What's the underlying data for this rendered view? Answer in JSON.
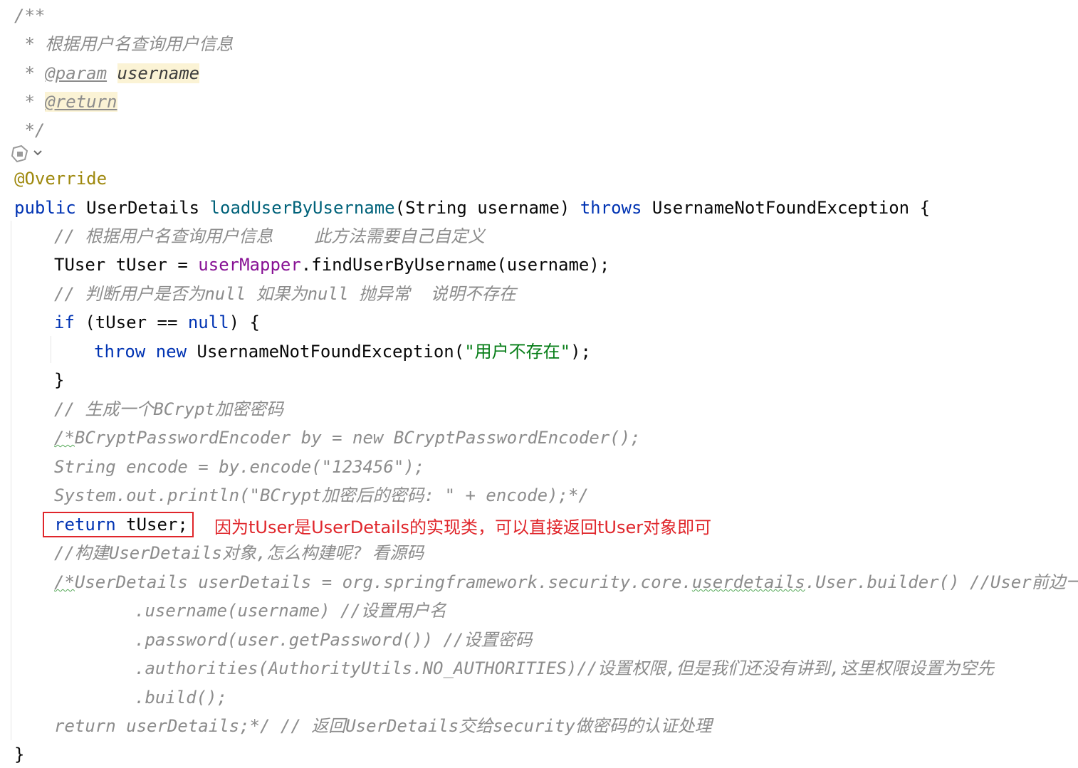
{
  "javadoc": {
    "open": "/**",
    "summary_prefix": " * ",
    "summary": "根据用户名查询用户信息",
    "param_prefix": " * ",
    "param_tag": "@param",
    "param_name": "username",
    "return_prefix": " * ",
    "return_tag": "@return",
    "close": " */"
  },
  "annotation": "@Override",
  "signature": {
    "modifier": "public",
    "return_type": " UserDetails ",
    "method": "loadUserByUsername",
    "params": "(String username) ",
    "throws_kw": "throws",
    "exception": " UsernameNotFoundException {"
  },
  "body": {
    "comment1": "// 根据用户名查询用户信息    此方法需要自己自定义",
    "find_pre": "TUser tUser = ",
    "find_field": "userMapper",
    "find_post": ".findUserByUsername(username);",
    "comment2": "// 判断用户是否为null 如果为null 抛异常  说明不存在",
    "if_kw": "if",
    "if_mid": " (tUser == ",
    "if_null": "null",
    "if_post": ") {",
    "throw_kw": "throw",
    "new_kw": "new",
    "throw_class": " UsernameNotFoundException(",
    "throw_str": "\"用户不存在\"",
    "throw_post": ");",
    "if_close": "}",
    "comment3": "// 生成一个BCrypt加密密码",
    "bc1_squig": "/*",
    "bc1": "BCryptPasswordEncoder by = new BCryptPasswordEncoder();",
    "bc2": "String encode = by.encode(\"123456\");",
    "bc3": "System.out.println(\"BCrypt加密后的密码: \" + encode);*/",
    "return_kw": "return",
    "return_val": " tUser;",
    "comment4": "//构建UserDetails对象,怎么构建呢? 看源码",
    "ud_squig": "/*",
    "ud_pre": "UserDetails userDetails = org.springframework.security.core.",
    "ud_squig2": "userdetails",
    "ud_post": ".User.builder() //User前边一定要",
    "b_username": ".username(username) //设置用户名",
    "b_password": ".password(user.getPassword()) //设置密码",
    "b_authorities": ".authorities(AuthorityUtils.NO_AUTHORITIES)//设置权限,但是我们还没有讲到,这里权限设置为空先",
    "b_build": ".build();",
    "ret_comment": "return userDetails;*/ // 返回UserDetails交给security做密码的认证处理"
  },
  "method_close": "}",
  "annotation_note": "因为tUser是UserDetails的实现类，可以直接返回tUser对象即可",
  "icons": {
    "gutter": "ai-assist-icon"
  },
  "colors": {
    "keyword": "#0033b3",
    "method": "#00627a",
    "field": "#871094",
    "annotation": "#9e880d",
    "string": "#067d17",
    "comment": "#8c8c8c",
    "note": "#e0262b"
  }
}
